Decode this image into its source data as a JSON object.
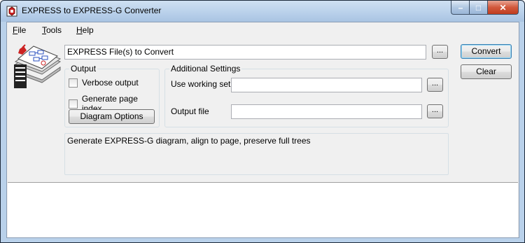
{
  "window": {
    "title": "EXPRESS to EXPRESS-G Converter",
    "controls": {
      "minimize": "–",
      "maximize": "□",
      "close": "✕"
    }
  },
  "menu": [
    {
      "label": "File",
      "mnemonic": "F",
      "rest": "ile"
    },
    {
      "label": "Tools",
      "mnemonic": "T",
      "rest": "ools"
    },
    {
      "label": "Help",
      "mnemonic": "H",
      "rest": "elp"
    }
  ],
  "input": {
    "express_files": {
      "value": "EXPRESS File(s) to Convert",
      "browse": "..."
    }
  },
  "buttons": {
    "convert": "Convert",
    "clear": "Clear",
    "diagram_options": "Diagram Options"
  },
  "output_group": {
    "title": "Output",
    "verbose": {
      "label": "Verbose output",
      "checked": false
    },
    "page_index": {
      "label": "Generate page index",
      "checked": false
    }
  },
  "additional": {
    "title": "Additional Settings",
    "working_set": {
      "label": "Use working set",
      "value": "",
      "browse": "..."
    },
    "output_file": {
      "label": "Output file",
      "value": "",
      "browse": "..."
    }
  },
  "info_text": "Generate EXPRESS-G diagram, align to page, preserve full trees",
  "log": ""
}
